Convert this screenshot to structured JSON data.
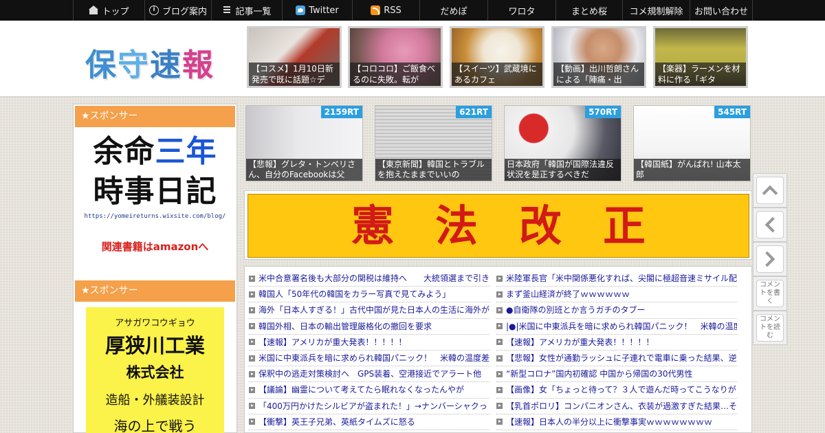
{
  "nav": [
    {
      "label": "トップ",
      "icon": "home-icon"
    },
    {
      "label": "ブログ案内",
      "icon": "info-icon"
    },
    {
      "label": "記事一覧",
      "icon": "list-icon"
    },
    {
      "label": "Twitter",
      "icon": "twitter-icon"
    },
    {
      "label": "RSS",
      "icon": "rss-icon"
    },
    {
      "label": "だめぽ"
    },
    {
      "label": "ワロタ"
    },
    {
      "label": "まとめ桜"
    },
    {
      "label": "コメ規制解除"
    },
    {
      "label": "お問い合わせ"
    }
  ],
  "logo": {
    "chars": [
      "保",
      "守",
      "速",
      "報"
    ]
  },
  "top_articles": [
    {
      "caption": "【コスメ】1月10日新発売で既に話題☆デ"
    },
    {
      "caption": "【コロコロ】ご飯食べるのに失敗。転が"
    },
    {
      "caption": "【スイーツ】武蔵境にあるカフェ"
    },
    {
      "caption": "【動画】出川哲朗さんによる「陣痛・出"
    },
    {
      "caption": "【楽器】ラーメンを材料に作る「ギタ"
    }
  ],
  "sponsor_label": "★スポンサー",
  "ad1": {
    "line1": "余命",
    "line1_blue": "三年",
    "line2": "時事日記",
    "url": "https://yomeireturns.wixsite.com/blog/",
    "amazon": "関連書籍はamazonへ"
  },
  "ad2": {
    "kana": "アサガワコウギョウ",
    "name": "厚狭川工業",
    "corp": "株式会社",
    "service": "造船・外艤装設計",
    "last": "海の上で戦う"
  },
  "rt_articles": [
    {
      "count": "2159RT",
      "caption": "【悲報】グレタ・トンベリさん、自分のFacebookは父"
    },
    {
      "count": "621RT",
      "caption": "【東京新聞】韓国とトラブルを抱えたままでいいの"
    },
    {
      "count": "570RT",
      "caption": "日本政府「韓国が国際法違反状況を是正するべきだ"
    },
    {
      "count": "545RT",
      "caption": "【韓国紙】がんばれ! 山本太郎"
    }
  ],
  "banner": {
    "text": "憲法改正"
  },
  "links_left": [
    "米中合意署名後も大部分の関税は維持へ　　大統領選まで引き",
    "韓国人「50年代の韓国をカラー写真で見てみよう」",
    "海外「日本人すぎる！」古代中国が見た日本人の生活に海外が",
    "韓国外相、日本の輸出管理厳格化の撤回を要求",
    "【速報】アメリカが重大発表！！！！！",
    "米国に中東派兵を暗に求められ韓国パニック！　米韓の温度差",
    "保釈中の逃走対策検討へ　GPS装着、空港接近でアラート他",
    "【議論】幽霊について考えてたら眠れなくなったんやが",
    "「400万円かけたシルビアが盗まれた！」→ナンバーシャクっ",
    "【衝撃】英王子兄弟、英紙タイムズに怒る"
  ],
  "links_right": [
    "米陸軍長官「米中関係悪化すれば、尖閣に極超音速ミサイル配",
    "まず釜山経済が終了ｗｗｗｗｗｗ",
    "●自衛隊の別班とか言うガチのタブー",
    "|●|米国に中東派兵を暗に求められ韓国パニック！　米韓の温度",
    "【速報】アメリカが重大発表！！！！！",
    "【悲報】女性が通勤ラッシュに子連れで電車に乗った結果、逆",
    "“新型コロナ”国内初確認 中国から帰国の30代男性",
    "【画像】女「ちょっと待って？３人で遊んだ時ってこうなりが",
    "【乳首ポロリ】コンパニオンさん、衣装が過激すぎた結果…そ",
    "【速報】日本人の半分以上に衝撃事実ｗｗｗｗｗｗｗｗ"
  ],
  "side_buttons": [
    {
      "name": "scroll-top-button",
      "label": ""
    },
    {
      "name": "prev-button",
      "label": ""
    },
    {
      "name": "next-button",
      "label": ""
    },
    {
      "name": "write-comment-button",
      "label": "コメントを書く"
    },
    {
      "name": "read-comment-button",
      "label": "コメントを読む"
    }
  ]
}
